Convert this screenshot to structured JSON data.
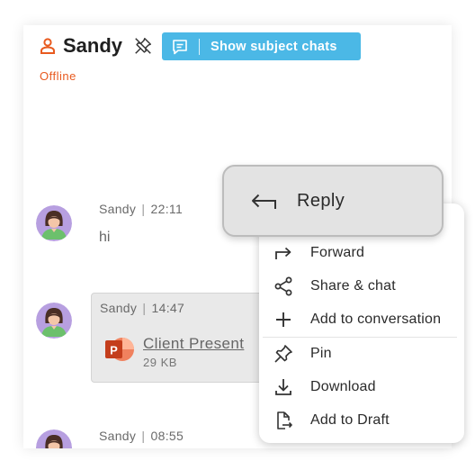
{
  "header": {
    "title": "Sandy",
    "subject_button_label": "Show subject chats",
    "status": "Offline"
  },
  "messages": [
    {
      "sender": "Sandy",
      "time": "22:11",
      "text": "hi"
    },
    {
      "sender": "Sandy",
      "time": "14:47",
      "file_name": "Client Present",
      "file_size": "29 KB"
    },
    {
      "sender": "Sandy",
      "time": "08:55"
    }
  ],
  "context_menu": {
    "reply_label": "Reply",
    "items": [
      {
        "label": "Forward",
        "icon": "forward-icon"
      },
      {
        "label": "Share & chat",
        "icon": "share-icon"
      },
      {
        "label": "Add to conversation",
        "icon": "plus-icon"
      },
      {
        "label": "Pin",
        "icon": "pin-icon"
      },
      {
        "label": "Download",
        "icon": "download-icon"
      },
      {
        "label": "Add to Draft",
        "icon": "add-to-draft-icon"
      }
    ]
  },
  "colors": {
    "status": "#e85a1f",
    "subject_button": "#4bb8e6",
    "avatar_bg": "#b79fe0"
  }
}
